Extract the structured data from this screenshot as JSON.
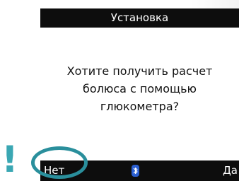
{
  "screen": {
    "title": "Установка",
    "message": "Хотите получить расчет\nболюса с помощью\nглюкометра?"
  },
  "softkeys": {
    "left_label": "Нет",
    "right_label": "Да"
  },
  "status": {
    "icon": "bluetooth-icon"
  },
  "annotation": {
    "mark": "!",
    "highlight_color": "#2a8f9c"
  }
}
